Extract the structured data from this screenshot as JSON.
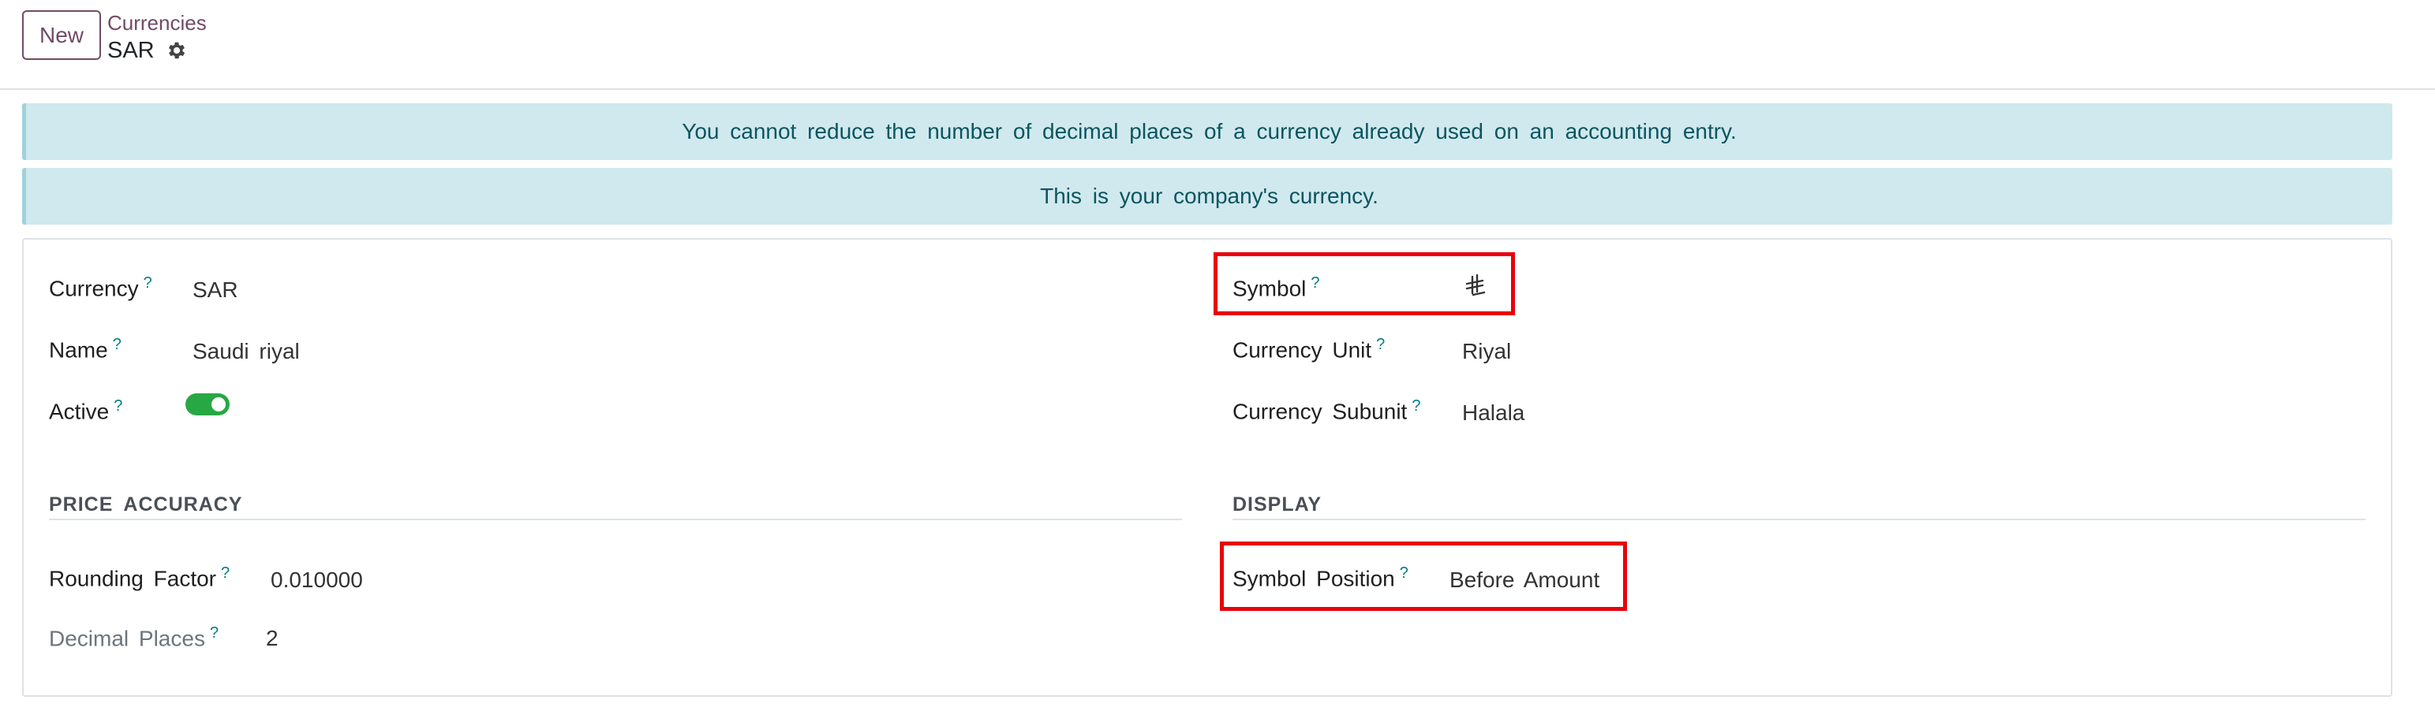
{
  "control_panel": {
    "new_button": "New",
    "breadcrumb_parent": "Currencies",
    "record_title": "SAR",
    "gear_icon": "gear-icon"
  },
  "alerts": [
    "You cannot reduce the number of decimal places of a currency already used on an accounting entry.",
    "This is your company's currency."
  ],
  "form": {
    "help_marker": "?",
    "left": {
      "currency_label": "Currency",
      "currency_value": "SAR",
      "name_label": "Name",
      "name_value": "Saudi riyal",
      "active_label": "Active",
      "active_value": true
    },
    "right": {
      "symbol_label": "Symbol",
      "symbol_value": "⃁",
      "unit_label": "Currency Unit",
      "unit_value": "Riyal",
      "subunit_label": "Currency Subunit",
      "subunit_value": "Halala"
    },
    "price_accuracy": {
      "title": "PRICE ACCURACY",
      "rounding_label": "Rounding Factor",
      "rounding_value": "0.010000",
      "decimal_label": "Decimal Places",
      "decimal_value": "2"
    },
    "display": {
      "title": "DISPLAY",
      "position_label": "Symbol Position",
      "position_value": "Before Amount"
    }
  },
  "colors": {
    "brand": "#714b67",
    "alert_bg": "#d0e9ee",
    "alert_text": "#0b5560",
    "toggle_on": "#28a745",
    "highlight": "#e8000b"
  }
}
